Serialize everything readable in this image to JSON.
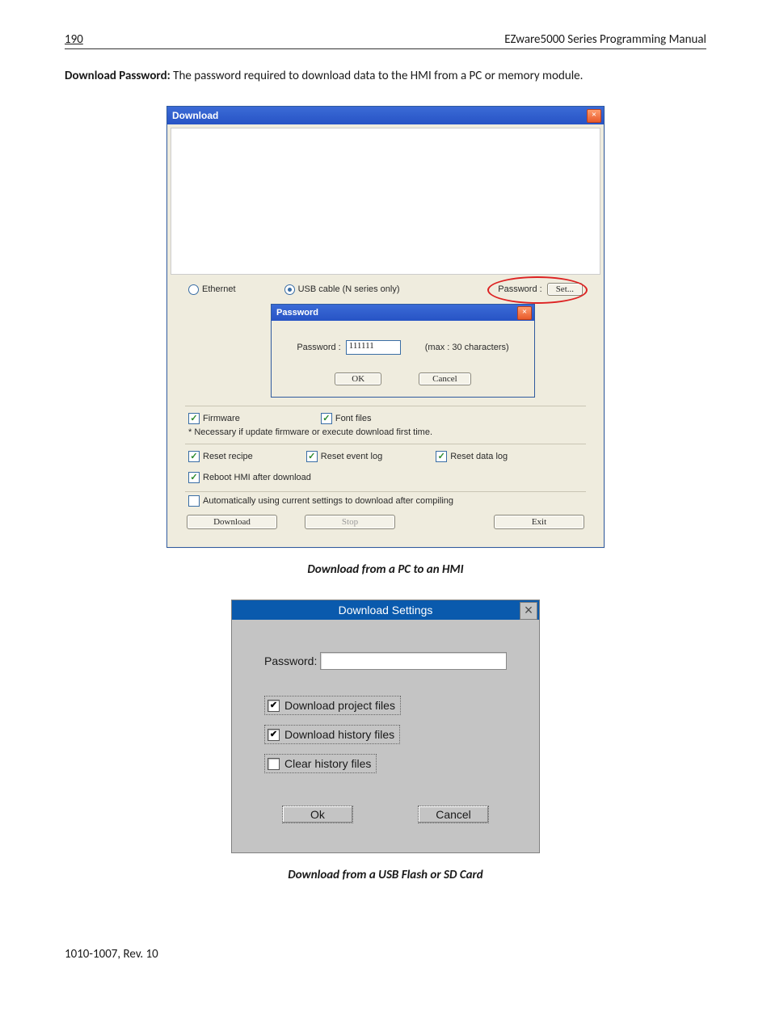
{
  "header": {
    "page": "190",
    "title": "EZware5000 Series Programming Manual"
  },
  "intro": {
    "bold": "Download Password:",
    "rest": " The password required to download data to the HMI from a PC or memory module."
  },
  "dlg1": {
    "title": "Download",
    "radio": {
      "ethernet": "Ethernet",
      "usb": "USB cable (N series only)"
    },
    "pwd_right": {
      "label": "Password :",
      "set_btn": "Set..."
    },
    "pwd_dlg": {
      "title": "Password",
      "label": "Password :",
      "value": "111111",
      "hint": "(max : 30 characters)",
      "ok": "OK",
      "cancel": "Cancel"
    },
    "firmware": "Firmware",
    "font": "Font files",
    "firmware_note": "* Necessary if update firmware or execute download first time.",
    "reset_recipe": "Reset recipe",
    "reset_event": "Reset event log",
    "reset_data": "Reset data log",
    "reboot": "Reboot HMI after download",
    "auto": "Automatically using current settings to download after compiling",
    "download_btn": "Download",
    "stop_btn": "Stop",
    "exit_btn": "Exit"
  },
  "caption1": "Download from a PC to an HMI",
  "dlg2": {
    "title": "Download Settings",
    "pwd_label": "Password:",
    "opt1": "Download project files",
    "opt2": "Download history files",
    "opt3": "Clear history files",
    "ok": "Ok",
    "cancel": "Cancel"
  },
  "caption2": "Download from a USB Flash or SD Card",
  "footer": "1010-1007, Rev. 10"
}
